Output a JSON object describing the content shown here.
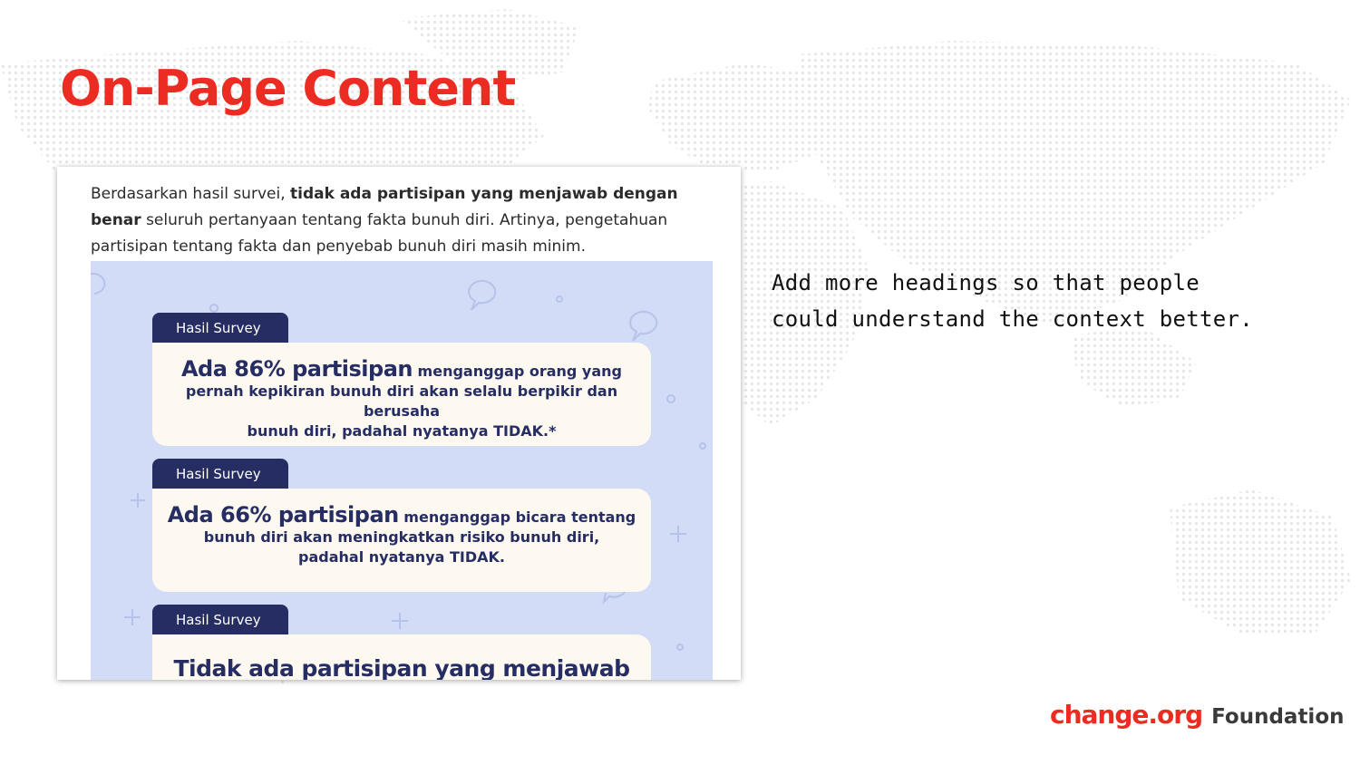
{
  "slide": {
    "title": "On-Page Content",
    "note": "Add more headings so that people could understand the context better."
  },
  "screenshot": {
    "paragraph": {
      "intro": "Berdasarkan hasil survei, ",
      "bold": "tidak ada partisipan yang menjawab dengan benar",
      "rest": " seluruh pertanyaan tentang fakta bunuh diri. Artinya, pengetahuan partisipan tentang fakta dan penyebab bunuh diri masih minim."
    },
    "cards": [
      {
        "tab": "Hasil Survey",
        "highlight": "Ada 86% partisipan",
        "line1": " menganggap orang yang",
        "line2": "pernah kepikiran bunuh diri akan selalu berpikir dan berusaha",
        "line3": "bunuh diri, padahal nyatanya TIDAK.*"
      },
      {
        "tab": "Hasil Survey",
        "highlight": "Ada 66% partisipan",
        "line1": " menganggap bicara tentang",
        "line2": "bunuh diri akan meningkatkan risiko bunuh diri,",
        "line3": "padahal nyatanya TIDAK."
      },
      {
        "tab": "Hasil Survey",
        "highlight": "Tidak ada partisipan yang menjawab"
      }
    ]
  },
  "brand": {
    "name": "change.org",
    "suffix": "Foundation"
  },
  "colors": {
    "title": "#ec2c22",
    "brand_red": "#ec2c22",
    "infographic_bg": "#d3dcf6",
    "tab_bg": "#262d63",
    "card_bg": "#fdf9f1",
    "map_dots": "#e6e6e6"
  }
}
